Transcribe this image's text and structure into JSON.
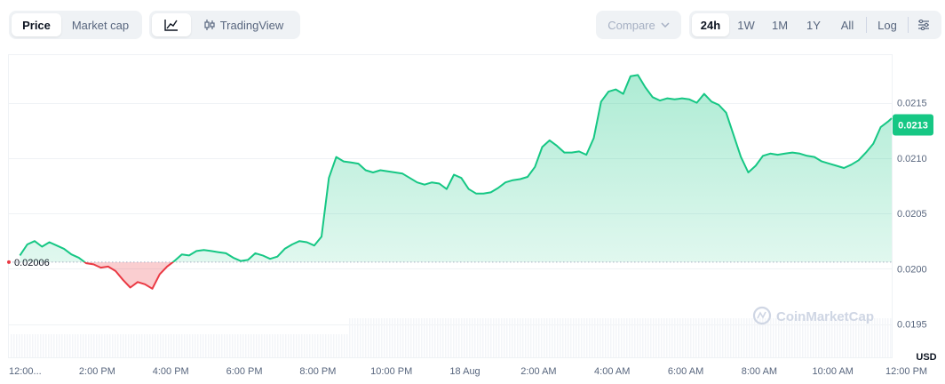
{
  "toolbar": {
    "price_tab": "Price",
    "market_cap_tab": "Market cap",
    "tradingview_label": "TradingView",
    "compare_label": "Compare",
    "ranges": [
      "24h",
      "1W",
      "1M",
      "1Y",
      "All"
    ],
    "active_range": "24h",
    "log_label": "Log"
  },
  "icons": {
    "line_chart": "line-chart-icon",
    "candles": "candlestick-icon",
    "chevron": "chevron-down-icon",
    "settings": "sliders-icon",
    "watermark": "coinmarketcap-logo"
  },
  "colors": {
    "up": "#16c784",
    "down": "#ea3943",
    "up_fill": "#16c784",
    "down_fill": "#ea3943",
    "grid": "#eff2f5",
    "axis_text": "#58667e"
  },
  "watermark_text": "CoinMarketCap",
  "chart_data": {
    "type": "area",
    "currency_label": "USD",
    "open_price": 0.02006,
    "open_price_label": "0.02006",
    "current_price": 0.0213,
    "current_price_label": "0.0213",
    "ylim": [
      0.0192,
      0.02193
    ],
    "y_ticks": [
      0.0195,
      0.02,
      0.0205,
      0.021,
      0.0215
    ],
    "y_tick_labels": [
      "0.0195",
      "0.0200",
      "0.0205",
      "0.0210",
      "0.0215"
    ],
    "x_range_hours": [
      0,
      24
    ],
    "x_ticks": [
      {
        "h": 0.4,
        "label": "12:00..."
      },
      {
        "h": 2.4,
        "label": "2:00 PM"
      },
      {
        "h": 4.4,
        "label": "4:00 PM"
      },
      {
        "h": 6.4,
        "label": "6:00 PM"
      },
      {
        "h": 8.4,
        "label": "8:00 PM"
      },
      {
        "h": 10.4,
        "label": "10:00 PM"
      },
      {
        "h": 12.4,
        "label": "18 Aug"
      },
      {
        "h": 14.4,
        "label": "2:00 AM"
      },
      {
        "h": 16.4,
        "label": "4:00 AM"
      },
      {
        "h": 18.4,
        "label": "6:00 AM"
      },
      {
        "h": 20.4,
        "label": "8:00 AM"
      },
      {
        "h": 22.4,
        "label": "10:00 AM"
      },
      {
        "h": 24.4,
        "label": "12:00 PM"
      }
    ],
    "x": [
      0.3,
      0.5,
      0.7,
      0.9,
      1.1,
      1.3,
      1.5,
      1.7,
      1.9,
      2.1,
      2.3,
      2.5,
      2.7,
      2.9,
      3.1,
      3.3,
      3.5,
      3.7,
      3.9,
      4.1,
      4.3,
      4.5,
      4.7,
      4.9,
      5.1,
      5.3,
      5.5,
      5.7,
      5.9,
      6.1,
      6.3,
      6.5,
      6.7,
      6.9,
      7.1,
      7.3,
      7.5,
      7.7,
      7.9,
      8.1,
      8.3,
      8.5,
      8.7,
      8.9,
      9.1,
      9.3,
      9.5,
      9.7,
      9.9,
      10.1,
      10.3,
      10.5,
      10.7,
      10.9,
      11.1,
      11.3,
      11.5,
      11.7,
      11.9,
      12.1,
      12.3,
      12.5,
      12.7,
      12.9,
      13.1,
      13.3,
      13.5,
      13.7,
      13.9,
      14.1,
      14.3,
      14.5,
      14.7,
      14.9,
      15.1,
      15.3,
      15.5,
      15.7,
      15.9,
      16.1,
      16.3,
      16.5,
      16.7,
      16.9,
      17.1,
      17.3,
      17.5,
      17.7,
      17.9,
      18.1,
      18.3,
      18.5,
      18.7,
      18.9,
      19.1,
      19.3,
      19.5,
      19.7,
      19.9,
      20.1,
      20.3,
      20.5,
      20.7,
      20.9,
      21.1,
      21.3,
      21.5,
      21.7,
      21.9,
      22.1,
      22.3,
      22.5,
      22.7,
      22.9,
      23.1,
      23.3,
      23.5,
      23.7,
      23.9,
      24.0
    ],
    "values": [
      0.02012,
      0.02022,
      0.02025,
      0.0202,
      0.02024,
      0.02021,
      0.02018,
      0.02013,
      0.0201,
      0.02005,
      0.02004,
      0.02001,
      0.02002,
      0.01998,
      0.0199,
      0.01983,
      0.01988,
      0.01986,
      0.01982,
      0.01995,
      0.02002,
      0.02007,
      0.02013,
      0.02012,
      0.02016,
      0.02017,
      0.02016,
      0.02015,
      0.02014,
      0.0201,
      0.02007,
      0.02008,
      0.02014,
      0.02012,
      0.02009,
      0.02011,
      0.02018,
      0.02022,
      0.02025,
      0.02024,
      0.02021,
      0.02029,
      0.02082,
      0.02101,
      0.02097,
      0.02096,
      0.02095,
      0.02089,
      0.02087,
      0.02089,
      0.02088,
      0.02087,
      0.02086,
      0.02082,
      0.02078,
      0.02076,
      0.02078,
      0.02077,
      0.02072,
      0.02085,
      0.02082,
      0.02072,
      0.02068,
      0.02068,
      0.02069,
      0.02073,
      0.02078,
      0.0208,
      0.02081,
      0.02083,
      0.02092,
      0.0211,
      0.02116,
      0.02111,
      0.02105,
      0.02105,
      0.02106,
      0.02103,
      0.02118,
      0.02151,
      0.0216,
      0.02162,
      0.02158,
      0.02174,
      0.02175,
      0.02164,
      0.02155,
      0.02152,
      0.02154,
      0.02153,
      0.02154,
      0.02153,
      0.0215,
      0.02158,
      0.02151,
      0.02148,
      0.02141,
      0.02121,
      0.02101,
      0.02087,
      0.02093,
      0.02102,
      0.02104,
      0.02103,
      0.02104,
      0.02105,
      0.02104,
      0.02102,
      0.02101,
      0.02097,
      0.02095,
      0.02093,
      0.02091,
      0.02094,
      0.02098,
      0.02105,
      0.02113,
      0.02128,
      0.02133,
      0.02136
    ],
    "volume_approx": "flat"
  }
}
